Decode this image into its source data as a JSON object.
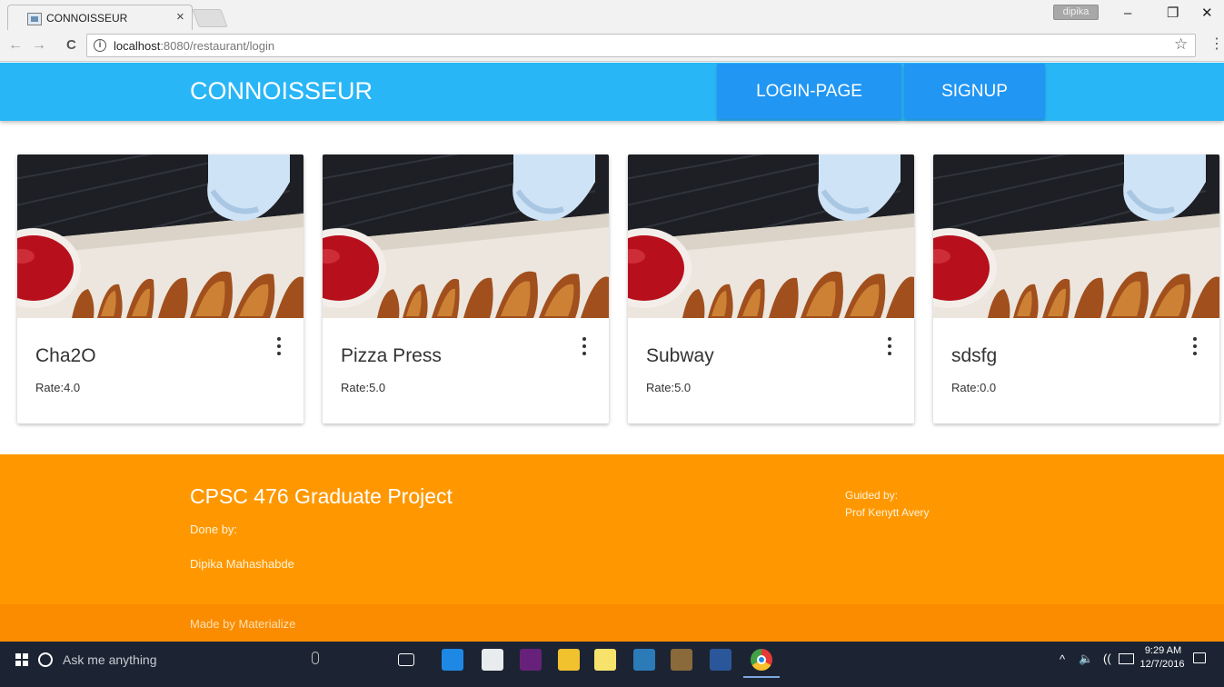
{
  "browser": {
    "tab_title": "CONNOISSEUR",
    "tab_close": "×",
    "profile_name": "dipika",
    "url_host": "localhost",
    "url_path": ":8080/restaurant/login",
    "info_glyph": "i",
    "back_glyph": "←",
    "forward_glyph": "→",
    "reload_glyph": "C",
    "star_glyph": "☆",
    "menu_glyph": "⋮",
    "minimize_glyph": "–",
    "restore_glyph": "❐",
    "close_glyph": "✕"
  },
  "navbar": {
    "brand": "CONNOISSEUR",
    "login_label": "LOGIN-PAGE",
    "signup_label": "SIGNUP",
    "bar_color": "#29b6f6",
    "button_color": "#2196f3"
  },
  "restaurants": [
    {
      "name": "Cha2O",
      "rate": "Rate:4.0"
    },
    {
      "name": "Pizza Press",
      "rate": "Rate:5.0"
    },
    {
      "name": "Subway",
      "rate": "Rate:5.0"
    },
    {
      "name": "sdsfg",
      "rate": "Rate:0.0"
    }
  ],
  "footer": {
    "title": "CPSC 476 Graduate Project",
    "done_by_label": "Done by:",
    "author": "Dipika Mahashabde",
    "guided_label": "Guided by:",
    "guide": "Prof Kenytt Avery",
    "copyright": "Made by Materialize",
    "color": "#ff9800"
  },
  "taskbar": {
    "search_placeholder": "Ask me anything",
    "time": "9:29 AM",
    "date": "12/7/2016",
    "icons": [
      "task-view-icon",
      "edge-icon",
      "store-icon",
      "visual-studio-icon",
      "file-explorer-icon",
      "sticky-notes-icon",
      "app-icon",
      "game-icon",
      "word-icon",
      "chrome-icon"
    ]
  }
}
